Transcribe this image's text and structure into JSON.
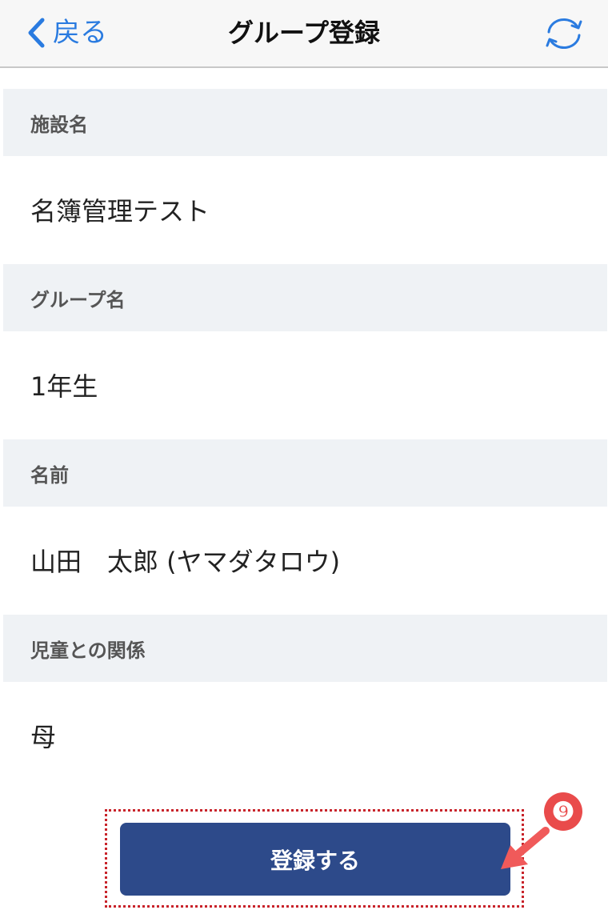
{
  "navbar": {
    "back_label": "戻る",
    "title": "グループ登録",
    "refresh_icon": "refresh-icon",
    "accent_color": "#2a7be0"
  },
  "sections": [
    {
      "label": "施設名",
      "value": "名簿管理テスト"
    },
    {
      "label": "グループ名",
      "value": "1年生"
    },
    {
      "label": "名前",
      "value": "山田　太郎 (ヤマダタロウ)"
    },
    {
      "label": "児童との関係",
      "value": "母"
    }
  ],
  "register_button": {
    "label": "登録する",
    "color": "#2d4a8a"
  },
  "annotation": {
    "step_number": "❾",
    "highlight_color": "#c8232a",
    "arrow_color": "#f05a5a"
  }
}
